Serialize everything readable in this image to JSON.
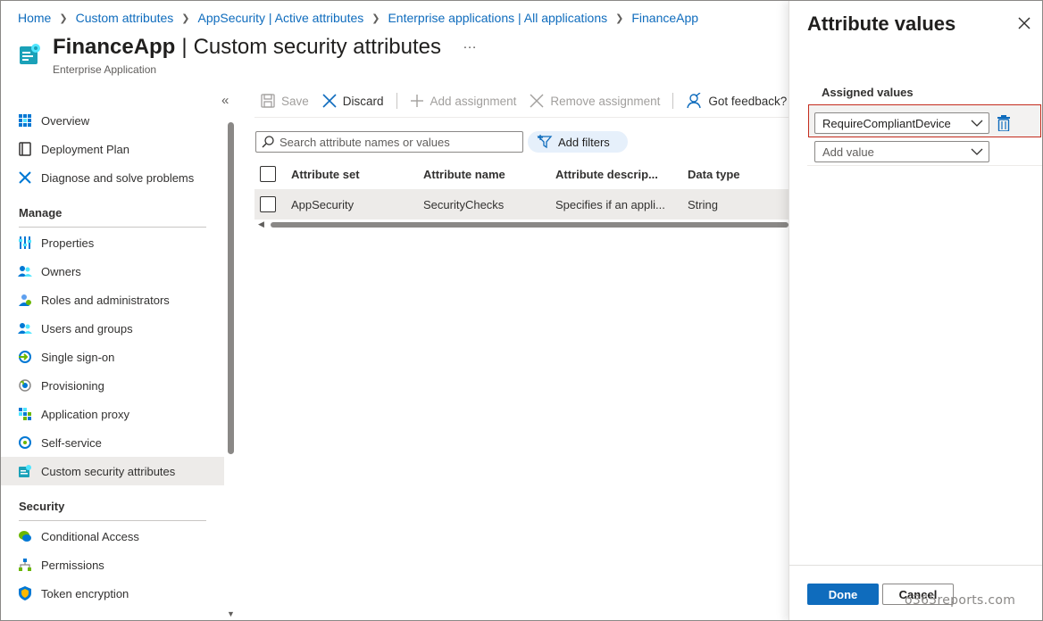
{
  "breadcrumb": [
    "Home",
    "Custom attributes",
    "AppSecurity | Active attributes",
    "Enterprise applications | All applications",
    "FinanceApp"
  ],
  "header": {
    "app_name": "FinanceApp",
    "separator": "|",
    "page_title": "Custom security attributes",
    "more": "…",
    "subtitle": "Enterprise Application"
  },
  "sidebar": {
    "collapse_glyph": "«",
    "top_items": [
      {
        "label": "Overview",
        "icon": "grid-icon"
      },
      {
        "label": "Deployment Plan",
        "icon": "book-icon"
      },
      {
        "label": "Diagnose and solve problems",
        "icon": "wrench-icon"
      }
    ],
    "sections": [
      {
        "title": "Manage",
        "items": [
          {
            "label": "Properties",
            "icon": "properties-icon"
          },
          {
            "label": "Owners",
            "icon": "owners-icon"
          },
          {
            "label": "Roles and administrators",
            "icon": "roles-icon"
          },
          {
            "label": "Users and groups",
            "icon": "users-icon"
          },
          {
            "label": "Single sign-on",
            "icon": "sso-icon"
          },
          {
            "label": "Provisioning",
            "icon": "provisioning-icon"
          },
          {
            "label": "Application proxy",
            "icon": "proxy-icon"
          },
          {
            "label": "Self-service",
            "icon": "self-service-icon"
          },
          {
            "label": "Custom security attributes",
            "icon": "custom-attributes-icon",
            "active": true
          }
        ]
      },
      {
        "title": "Security",
        "items": [
          {
            "label": "Conditional Access",
            "icon": "conditional-access-icon"
          },
          {
            "label": "Permissions",
            "icon": "permissions-icon"
          },
          {
            "label": "Token encryption",
            "icon": "shield-icon"
          }
        ]
      }
    ]
  },
  "toolbar": {
    "save": "Save",
    "discard": "Discard",
    "add_assignment": "Add assignment",
    "remove_assignment": "Remove assignment",
    "feedback": "Got feedback?"
  },
  "search": {
    "placeholder": "Search attribute names or values"
  },
  "filters": {
    "label": "Add filters"
  },
  "table": {
    "columns": [
      "Attribute set",
      "Attribute name",
      "Attribute descrip...",
      "Data type"
    ],
    "rows": [
      [
        "AppSecurity",
        "SecurityChecks",
        "Specifies if an appli...",
        "String"
      ]
    ]
  },
  "panel": {
    "title": "Attribute values",
    "assigned_label": "Assigned values",
    "selected_value": "RequireCompliantDevice",
    "add_value_placeholder": "Add value",
    "done": "Done",
    "cancel": "Cancel"
  },
  "watermark": "o365reports.com",
  "colors": {
    "accent": "#0f6cbd",
    "highlight_border": "#c42b1c",
    "active_nav": "#edebe9"
  }
}
